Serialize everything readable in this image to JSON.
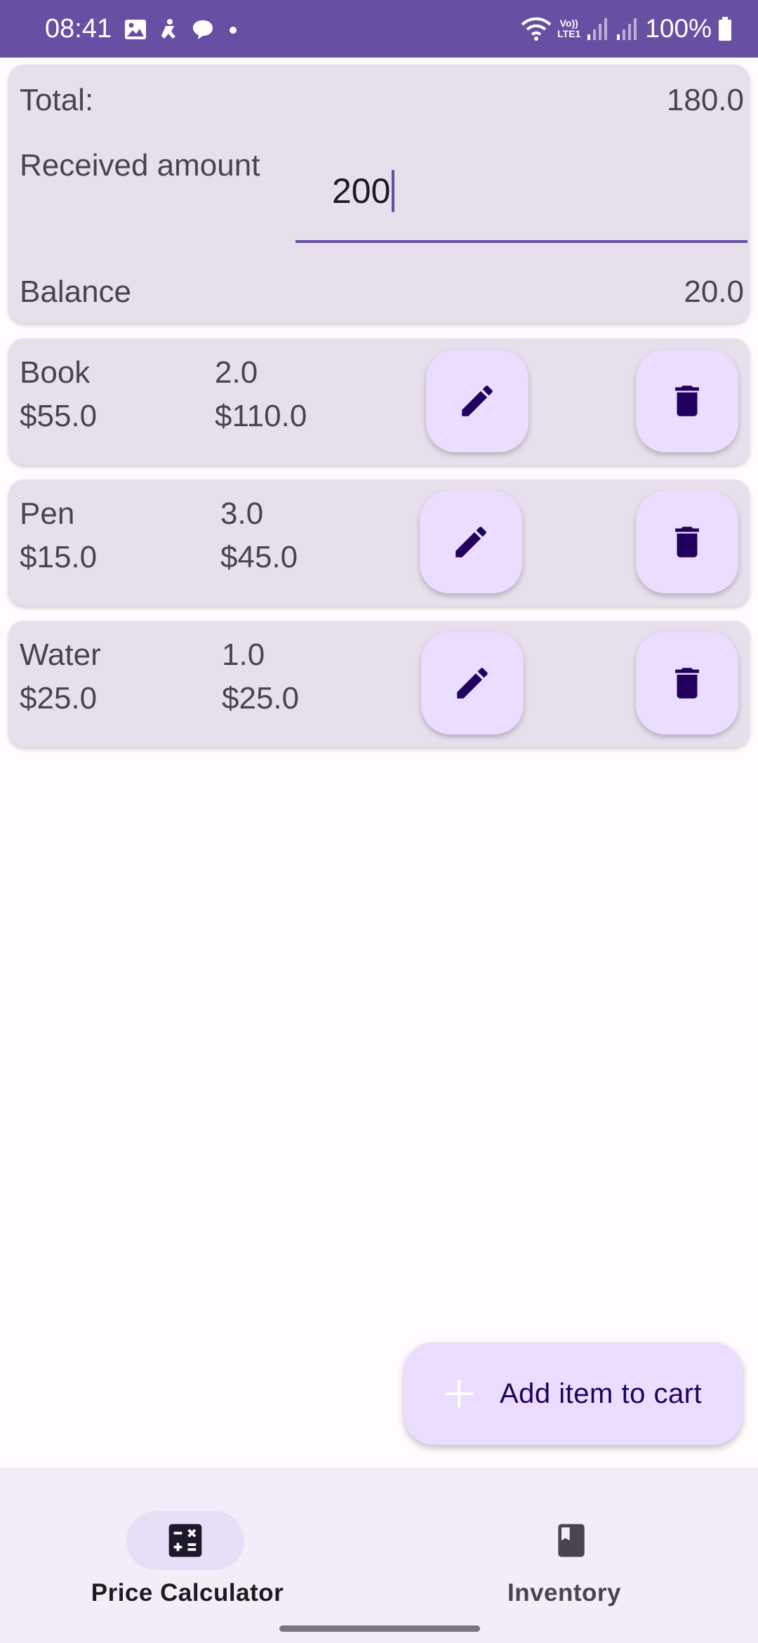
{
  "status_bar": {
    "time": "08:41",
    "battery": "100%",
    "network_label": "LTE1",
    "volte_label": "Vo))",
    "icons": [
      "gallery-icon",
      "accessibility-icon",
      "chat-bubble-icon",
      "dot-icon",
      "wifi-icon",
      "signal-icon",
      "battery-icon"
    ]
  },
  "summary": {
    "total_label": "Total:",
    "total_value": "180.0",
    "received_label": "Received amount",
    "received_value": "200",
    "balance_label": "Balance",
    "balance_value": "20.0"
  },
  "items": [
    {
      "name": "Book",
      "price": "$55.0",
      "quantity": "2.0",
      "subtotal": "$110.0"
    },
    {
      "name": "Pen",
      "price": "$15.0",
      "quantity": "3.0",
      "subtotal": "$45.0"
    },
    {
      "name": "Water",
      "price": "$25.0",
      "quantity": "1.0",
      "subtotal": "$25.0"
    }
  ],
  "fab": {
    "label": "Add item to cart",
    "icon": "plus-icon"
  },
  "bottom_nav": {
    "items": [
      {
        "label": "Price Calculator",
        "icon": "calculator-icon",
        "selected": true
      },
      {
        "label": "Inventory",
        "icon": "book-icon",
        "selected": false
      }
    ]
  },
  "colors": {
    "primary": "#6750A4",
    "card_background": "#E7E0EC",
    "button_container": "#EADDFF",
    "on_button_container": "#21005D",
    "text_secondary": "#49454F",
    "nav_background": "#F3EDF7",
    "nav_indicator": "#E8DEF8"
  }
}
